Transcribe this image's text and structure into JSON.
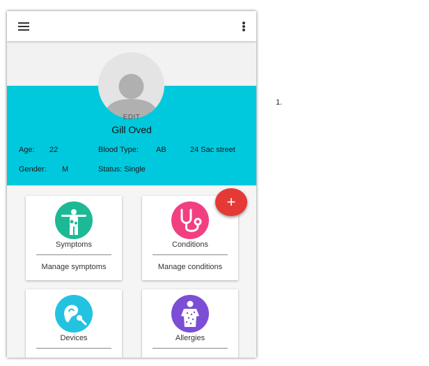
{
  "appbar": {
    "menu_icon": "hamburger-icon",
    "more_icon": "more-vert-icon"
  },
  "profile": {
    "edit_label": "EDIT",
    "name": "Gill Oved",
    "age_label": "Age:",
    "age": "22",
    "blood_label": "Blood Type:",
    "blood": "AB",
    "address": "24 Sac street",
    "gender_label": "Gender:",
    "gender": "M",
    "status": "Status: Single"
  },
  "fab": {
    "label": "+"
  },
  "cards": [
    {
      "title": "Symptoms",
      "subtitle": "Manage symptoms",
      "icon": "person-pain-icon",
      "color": "#1db995"
    },
    {
      "title": "Conditions",
      "subtitle": "Manage conditions",
      "icon": "stethoscope-icon",
      "color": "#f23f82"
    },
    {
      "title": "Devices",
      "subtitle": "",
      "icon": "hearing-aid-icon",
      "color": "#23c2e1"
    },
    {
      "title": "Allergies",
      "subtitle": "",
      "icon": "skin-rash-icon",
      "color": "#7c4ed6"
    }
  ],
  "page_number": "1."
}
